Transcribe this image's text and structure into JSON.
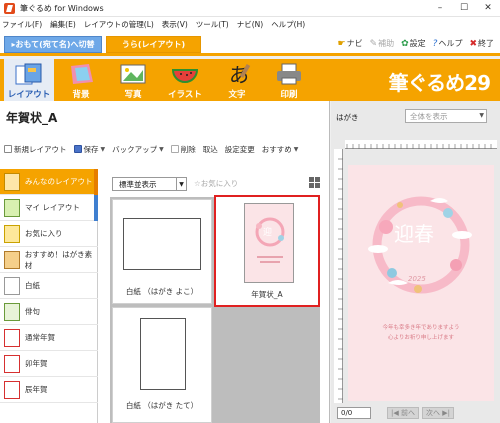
{
  "window": {
    "title": "筆ぐるめ for Windows",
    "controls": [
      "–",
      "☐",
      "✕"
    ]
  },
  "menu": [
    "ファイル(F)",
    "編集(E)",
    "レイアウトの管理(L)",
    "表示(V)",
    "ツール(T)",
    "ナビ(N)",
    "ヘルプ(H)"
  ],
  "modes": {
    "omote": "▸おもて(宛て名)へ切替",
    "ura": "うら(レイアウト)"
  },
  "tools": {
    "navi": "ナビ",
    "hojo": "補助",
    "settei": "設定",
    "help": "ヘルプ",
    "close": "終了"
  },
  "ribbon": {
    "layout": "レイアウト",
    "haikei": "背景",
    "shashin": "写真",
    "illust": "イラスト",
    "moji": "文字",
    "insatsu": "印刷",
    "brand": "筆ぐるめ29"
  },
  "doc": {
    "title": "年賀状_A"
  },
  "toolbar": {
    "new": "新規レイアウト",
    "save": "保存",
    "backup": "バックアップ",
    "delete": "削除",
    "import": "取込",
    "settings": "設定変更",
    "recommend": "おすすめ"
  },
  "sidebar": {
    "items": [
      {
        "label": "みんなのレイアウト",
        "active": true
      },
      {
        "label": "マイ レイアウト",
        "active": false
      },
      {
        "label": "お気に入り",
        "active": false
      },
      {
        "label": "おすすめ！はがき素材",
        "active": false
      },
      {
        "label": "白紙",
        "active": false
      },
      {
        "label": "俳句",
        "active": false
      },
      {
        "label": "通常年賀",
        "active": false
      },
      {
        "label": "卯年賀",
        "active": false
      },
      {
        "label": "辰年賀",
        "active": false
      }
    ]
  },
  "list": {
    "sort": "標準並表示",
    "fav": "☆お気に入り",
    "thumbs": [
      {
        "caption": "白紙 （はがき よこ）"
      },
      {
        "caption": "年賀状_A"
      },
      {
        "caption": "白紙 （はがき たて）"
      }
    ]
  },
  "preview": {
    "label": "はがき",
    "view": "全体を表示",
    "card_kanji": "迎春",
    "card_year": "2025",
    "card_line1": "今年も幸多き年でありますよう",
    "card_line2": "心よりお祈り申し上げます",
    "page": "0/0",
    "prev": "|◀ 前へ",
    "next": "次へ ▶|"
  }
}
